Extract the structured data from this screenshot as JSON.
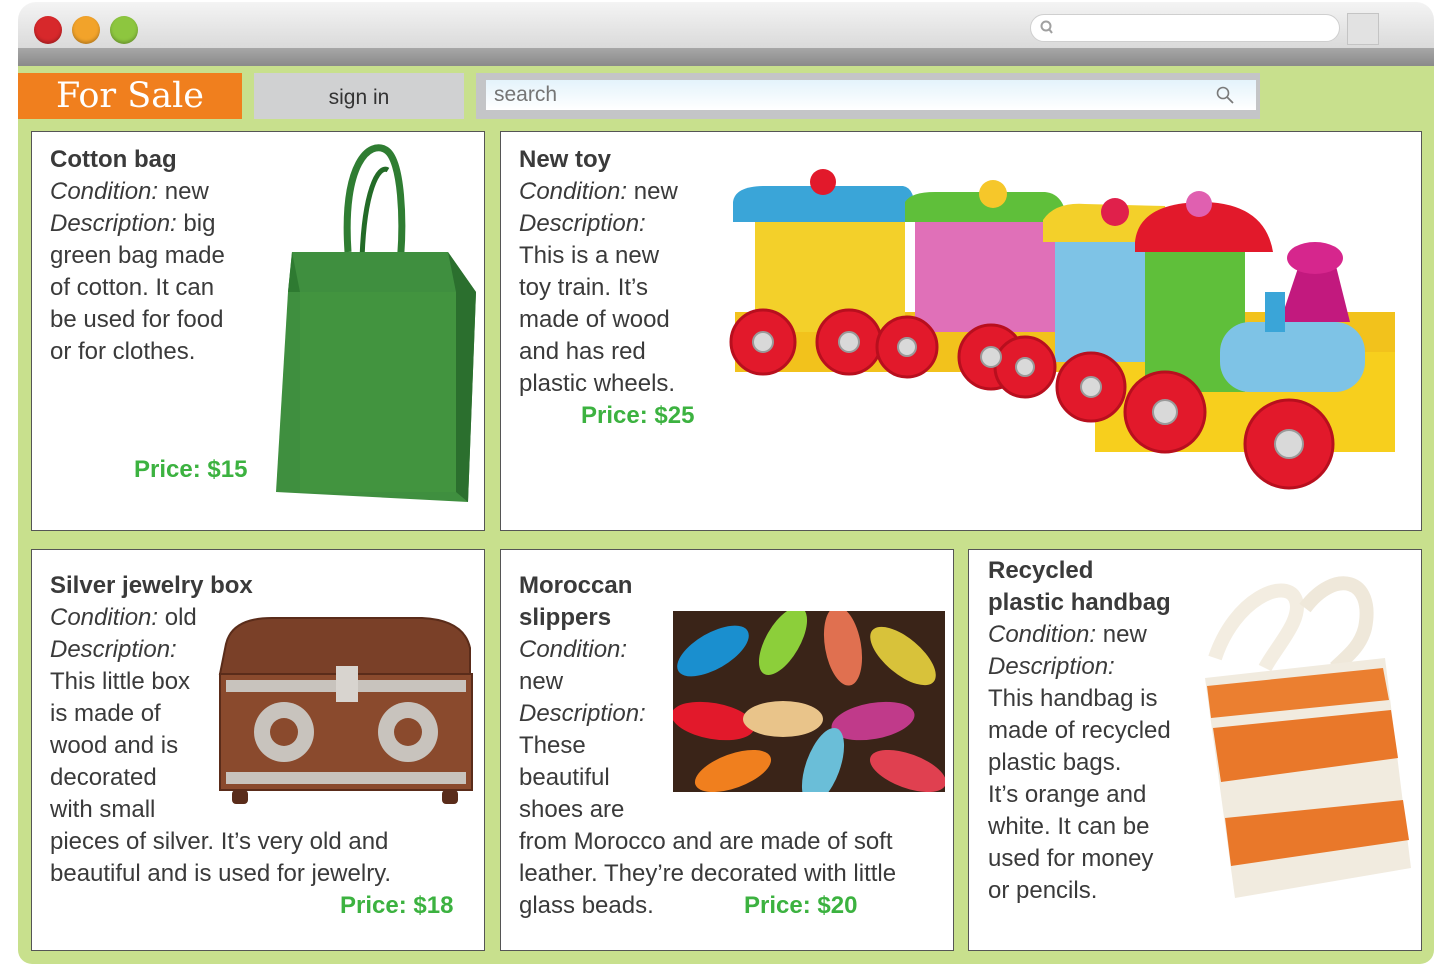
{
  "header": {
    "brand": "For Sale",
    "sign_in": "sign in",
    "search_placeholder": "search"
  },
  "labels": {
    "condition": "Condition:",
    "description": "Description:",
    "price_prefix": "Price:"
  },
  "colors": {
    "page_bg": "#c8e08d",
    "brand": "#f07f1e",
    "price": "#3cb240"
  },
  "items": [
    {
      "title": "Cotton bag",
      "condition": "new",
      "description_lines": [
        "big",
        "green bag made",
        "of cotton. It can",
        "be used for food",
        "or for clothes."
      ],
      "price": "$15",
      "image": "green-cotton-bag"
    },
    {
      "title": "New toy",
      "condition": "new",
      "description_lines": [
        "This is a new",
        "toy train. It’s",
        "made of wood",
        "and has red",
        "plastic wheels."
      ],
      "price": "$25",
      "image": "wooden-toy-train"
    },
    {
      "title": "Silver jewelry box",
      "condition": "old",
      "description_lines": [
        "This little box",
        "is made of",
        "wood and is",
        "decorated",
        "with small",
        "pieces of silver. It’s very old and",
        "beautiful and is used for jewelry."
      ],
      "price": "$18",
      "image": "silver-jewelry-box"
    },
    {
      "title_lines": [
        "Moroccan",
        "slippers"
      ],
      "condition": "new",
      "description_lines": [
        "These",
        "beautiful",
        "shoes are",
        "from Morocco and are made of soft",
        "leather. They’re decorated with little",
        "glass beads."
      ],
      "price": "$20",
      "image": "moroccan-slippers"
    },
    {
      "title_lines": [
        "Recycled",
        "plastic handbag"
      ],
      "condition": "new",
      "description_lines": [
        "This handbag is",
        "made of recycled",
        "plastic bags.",
        "It’s orange and",
        "white. It can be",
        "used for money",
        "or pencils."
      ],
      "image": "recycled-plastic-handbag"
    }
  ]
}
